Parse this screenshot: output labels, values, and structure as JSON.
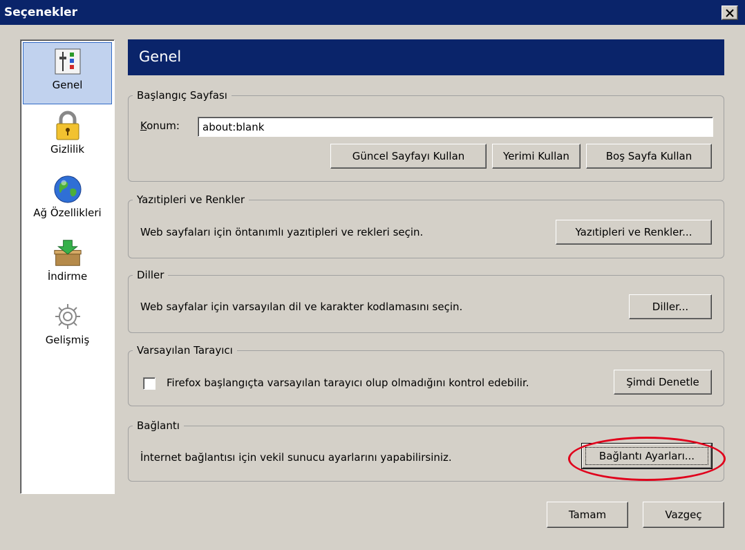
{
  "window": {
    "title": "Seçenekler",
    "close_label": "×"
  },
  "sidebar": {
    "items": [
      {
        "label": "Genel",
        "icon": "general-sliders-icon",
        "selected": true
      },
      {
        "label": "Gizlilik",
        "icon": "padlock-icon",
        "selected": false
      },
      {
        "label": "Ağ Özellikleri",
        "icon": "globe-icon",
        "selected": false
      },
      {
        "label": "İndirme",
        "icon": "download-box-icon",
        "selected": false
      },
      {
        "label": "Gelişmiş",
        "icon": "gear-icon",
        "selected": false
      }
    ]
  },
  "page": {
    "title": "Genel"
  },
  "startup": {
    "legend": "Başlangıç Sayfası",
    "location_label": "Konum:",
    "location_value": "about:blank",
    "btn_current": "Güncel Sayfayı Kullan",
    "btn_bookmark": "Yerimi Kullan",
    "btn_blank": "Boş Sayfa Kullan"
  },
  "fonts": {
    "legend": "Yazıtipleri ve Renkler",
    "description": "Web sayfaları için öntanımlı yazıtipleri ve rekleri seçin.",
    "button": "Yazıtipleri ve Renkler..."
  },
  "languages": {
    "legend": "Diller",
    "description": "Web sayfalar için varsayılan dil ve karakter kodlamasını seçin.",
    "button": "Diller..."
  },
  "default_browser": {
    "legend": "Varsayılan Tarayıcı",
    "checkbox_label": "Firefox başlangıçta varsayılan tarayıcı olup olmadığını kontrol edebilir.",
    "checked": false,
    "button": "Şimdi Denetle"
  },
  "connection": {
    "legend": "Bağlantı",
    "description": "İnternet bağlantısı için vekil sunucu ayarlarını yapabilirsiniz.",
    "button": "Bağlantı Ayarları..."
  },
  "footer": {
    "ok": "Tamam",
    "cancel": "Vazgeç"
  },
  "colors": {
    "titlebar": "#0a246a",
    "window_bg": "#d4d0c8",
    "highlight_ellipse": "#e0001b",
    "selection": "#c1d2ee"
  }
}
